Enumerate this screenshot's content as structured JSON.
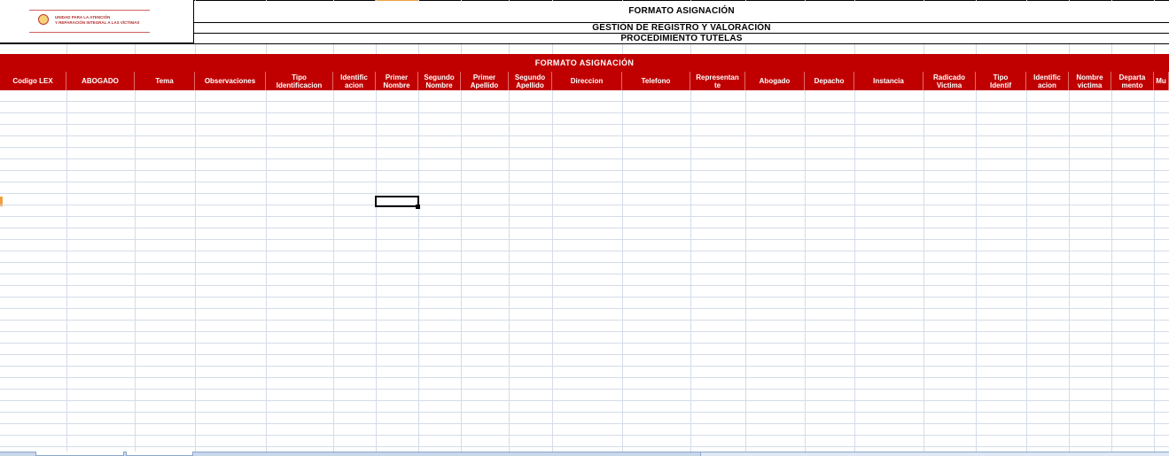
{
  "logo": {
    "line1": "UNIDAD PARA LA ATENCIÓN",
    "line2": "Y REPARACIÓN INTEGRAL A LAS VÍCTIMAS"
  },
  "header": {
    "title": "FORMATO ASIGNACIÓN",
    "subtitle": "GESTIÓN DE REGISTRO Y VALORACIÓN",
    "procedure": "PROCEDIMIENTO TUTELAS"
  },
  "banner": "FORMATO ASIGNACIÓN",
  "columns": [
    "Codigo LEX",
    "ABOGADO",
    "Tema",
    "Observaciones",
    "Tipo\nIdentificacion",
    "Identific\nacion",
    "Primer\nNombre",
    "Segundo\nNombre",
    "Primer\nApellido",
    "Segundo\nApellido",
    "Direccion",
    "Telefono",
    "Representan\nte",
    "Abogado",
    "Depacho",
    "Instancia",
    "Radicado\nVictima",
    "Tipo\nIdentif",
    "Identific\nacion",
    "Nombre\nvictima",
    "Departa\nmento",
    "Mu"
  ],
  "colors": {
    "header_red": "#c00000",
    "grid": "#d4dce8",
    "logo_red": "#b03030"
  }
}
